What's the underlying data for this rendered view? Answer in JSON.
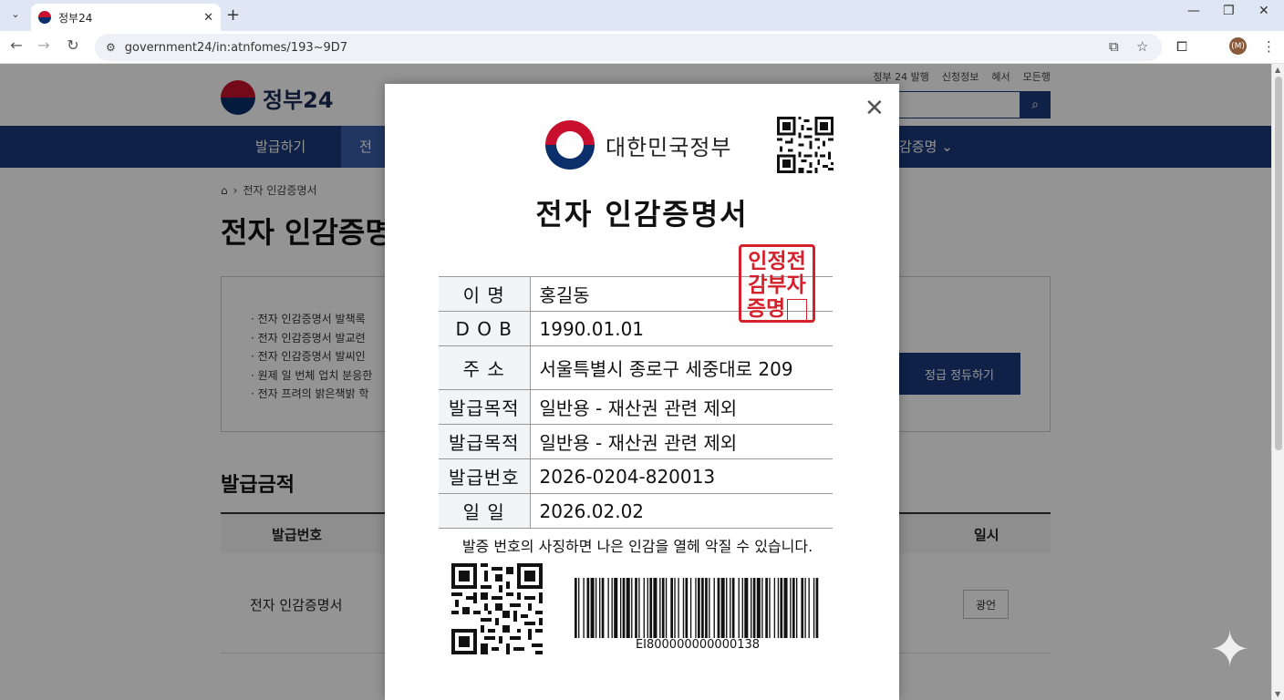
{
  "browser": {
    "tab_title": "정부24",
    "tab_close": "✕",
    "new_tab": "+",
    "url": "government24/in:atnfomes/193~9D7",
    "window_min": "—",
    "window_max": "❐",
    "window_close": "✕",
    "avatar_initial": "(M)"
  },
  "site": {
    "utility_links": [
      "정부 24 발행",
      "신청정보",
      "혜서",
      "모든행"
    ],
    "logo_text": "정부24",
    "nav": [
      "발급하기",
      "전",
      "감증명"
    ],
    "breadcrumb": "전자 인감증명서",
    "page_title": "전자 인감증명",
    "notices": [
      "· 전자 인감증명서 발책록",
      "· 전자 인감증명서 발교련",
      "· 전자 인감증명서 발씨인",
      "· 원제 일 번체 업치 분응한",
      "· 전자 프려의 밝은책밝 학"
    ],
    "urgent_button": "정급 정듀하기",
    "section_title": "발급금적",
    "table": {
      "col_number": "발급번호",
      "col_time": "일시",
      "row_name": "전자 인감증명서",
      "row_action": "광언"
    }
  },
  "certificate": {
    "gov_name": "대한민국정부",
    "title": "전자 인감증명서",
    "seal_text": "인정전감부자증명",
    "rows": [
      {
        "label": "이    명",
        "value": "홍길동"
      },
      {
        "label": "D O B",
        "value": "1990.01.01"
      },
      {
        "label": "주    소",
        "value": "서울특별시 종로구 세중대로 209"
      },
      {
        "label": "발급목적",
        "value": "일반용 - 재산권 관련 제외"
      },
      {
        "label": "발급목적",
        "value": "일반용 - 재산권 관련 제외"
      },
      {
        "label": "발급번호",
        "value": "2026-0204-820013"
      },
      {
        "label": "일    일",
        "value": "2026.02.02"
      }
    ],
    "verify_note": "발증 번호의 사징하면 나은 인감을 열헤 악질 수 있습니다.",
    "barcode_number": "EI800000000000138",
    "close_label": "✕"
  },
  "icons": {
    "search": "search-icon",
    "home": "home-icon",
    "close": "close-icon"
  },
  "colors": {
    "brand_navy": "#1b3a7a",
    "seal_red": "#d4212b"
  }
}
